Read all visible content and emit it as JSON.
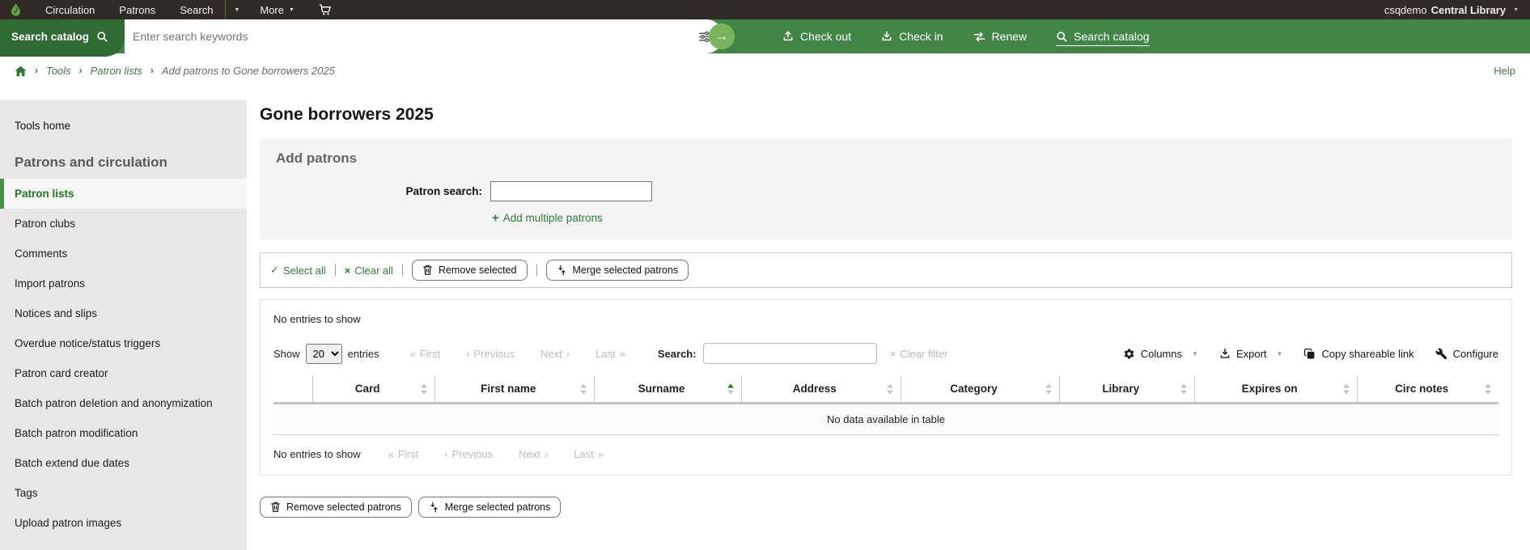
{
  "topbar": {
    "nav_circulation": "Circulation",
    "nav_patrons": "Patrons",
    "nav_search": "Search",
    "nav_more": "More",
    "user_account": "csqdemo",
    "user_library": "Central Library"
  },
  "searchbar": {
    "catalog_button_label": "Search catalog",
    "input_placeholder": "Enter search keywords",
    "link_check_out": "Check out",
    "link_check_in": "Check in",
    "link_renew": "Renew",
    "link_search_catalog": "Search catalog"
  },
  "breadcrumb": {
    "link_tools": "Tools",
    "link_patron_lists": "Patron lists",
    "current_page": "Add patrons to Gone borrowers 2025",
    "help_link": "Help"
  },
  "sidebar": {
    "tools_home": "Tools home",
    "section_heading": "Patrons and circulation",
    "items": [
      {
        "label": "Patron lists",
        "active": true
      },
      {
        "label": "Patron clubs",
        "active": false
      },
      {
        "label": "Comments",
        "active": false
      },
      {
        "label": "Import patrons",
        "active": false
      },
      {
        "label": "Notices and slips",
        "active": false
      },
      {
        "label": "Overdue notice/status triggers",
        "active": false
      },
      {
        "label": "Patron card creator",
        "active": false
      },
      {
        "label": "Batch patron deletion and anonymization",
        "active": false
      },
      {
        "label": "Batch patron modification",
        "active": false
      },
      {
        "label": "Batch extend due dates",
        "active": false
      },
      {
        "label": "Tags",
        "active": false
      },
      {
        "label": "Upload patron images",
        "active": false
      }
    ]
  },
  "main": {
    "page_title": "Gone borrowers 2025",
    "add_patrons": {
      "heading": "Add patrons",
      "search_label": "Patron search:",
      "search_value": "",
      "add_multiple": "Add multiple patrons"
    },
    "toolbar": {
      "select_all": "Select all",
      "clear_all": "Clear all",
      "remove_selected": "Remove selected",
      "merge_selected": "Merge selected patrons"
    },
    "table": {
      "no_entries_top": "No entries to show",
      "show_label": "Show",
      "page_size": "20",
      "entries_label": "entries",
      "pagination": {
        "first": "First",
        "previous": "Previous",
        "next": "Next",
        "last": "Last"
      },
      "search_label": "Search:",
      "search_value": "",
      "clear_filter": "Clear filter",
      "columns_button": "Columns",
      "export_button": "Export",
      "copy_link_button": "Copy shareable link",
      "configure_button": "Configure",
      "headers": [
        "Card",
        "First name",
        "Surname",
        "Address",
        "Category",
        "Library",
        "Expires on",
        "Circ notes"
      ],
      "sorted_column": "Surname",
      "sort_direction": "asc",
      "empty_message": "No data available in table",
      "no_entries_bottom": "No entries to show"
    },
    "actions": {
      "remove_selected_patrons": "Remove selected patrons",
      "merge_selected_patrons": "Merge selected patrons"
    }
  },
  "icons": {
    "caret_down": "▼",
    "chevron_right": "›",
    "first": "«",
    "previous": "‹",
    "next": "›",
    "last": "»",
    "submit_arrow": "→",
    "check": "✓",
    "clear": "×",
    "plus": "+"
  },
  "colors": {
    "topbar_bg": "#302a27",
    "header_green": "#428647",
    "pill_green": "#2f6b33",
    "link_green": "#3a7d3a",
    "active_sidebar_green": "#1f7a1f"
  }
}
